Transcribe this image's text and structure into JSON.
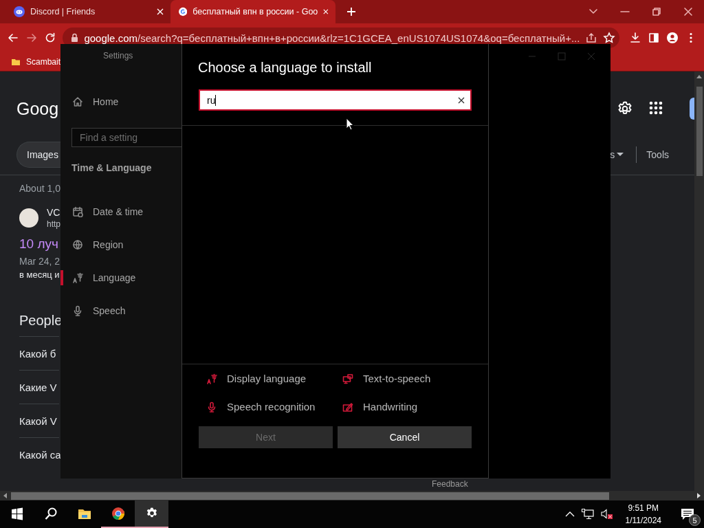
{
  "browser": {
    "tabs": [
      {
        "title": "Discord | Friends",
        "selected": false
      },
      {
        "title": "бесплатный впн в россии - Goo",
        "selected": true
      }
    ],
    "address": {
      "host": "google.com",
      "path": "/search?q=бесплатный+впн+в+россии&rlz=1C1GCEA_enUS1074US1074&oq=бесплатный+..."
    },
    "bookmarks": [
      {
        "label": "Scambait"
      }
    ],
    "page": {
      "logo": "Goog",
      "chips": [
        "Images"
      ],
      "filter": "s",
      "tools": "Tools",
      "result_count": "About 1,0",
      "result": {
        "site": "VC",
        "url": "http",
        "title": "10 луч",
        "date": "Mar 24, 2",
        "snippet": "в месяц и"
      },
      "people_also_ask": {
        "heading": "People",
        "questions": [
          "Какой б",
          "Какие V",
          "Какой V",
          "Какой са"
        ]
      }
    }
  },
  "settings": {
    "title": "Settings",
    "home": "Home",
    "search": {
      "placeholder": "Find a setting"
    },
    "section": "Time & Language",
    "nav": [
      {
        "label": "Date & time",
        "selected": false
      },
      {
        "label": "Region",
        "selected": false
      },
      {
        "label": "Language",
        "selected": true
      },
      {
        "label": "Speech",
        "selected": false
      }
    ],
    "dialog": {
      "title": "Choose a language to install",
      "search": {
        "value": "ru"
      },
      "features": [
        {
          "label": "Display language"
        },
        {
          "label": "Text-to-speech"
        },
        {
          "label": "Speech recognition"
        },
        {
          "label": "Handwriting"
        }
      ],
      "buttons": [
        {
          "label": "Next",
          "disabled": true
        },
        {
          "label": "Cancel",
          "disabled": false
        }
      ]
    },
    "feedback": "Feedback"
  },
  "taskbar": {
    "apps": [
      {
        "kind": "start",
        "open": false,
        "selected": false
      },
      {
        "kind": "search",
        "open": false,
        "selected": false
      },
      {
        "kind": "explorer",
        "open": false,
        "selected": false
      },
      {
        "kind": "chrome",
        "open": true,
        "selected": false
      },
      {
        "kind": "settings",
        "open": true,
        "selected": true
      }
    ],
    "time": "9:51 PM",
    "date": "1/11/2024",
    "notifications": "5"
  }
}
